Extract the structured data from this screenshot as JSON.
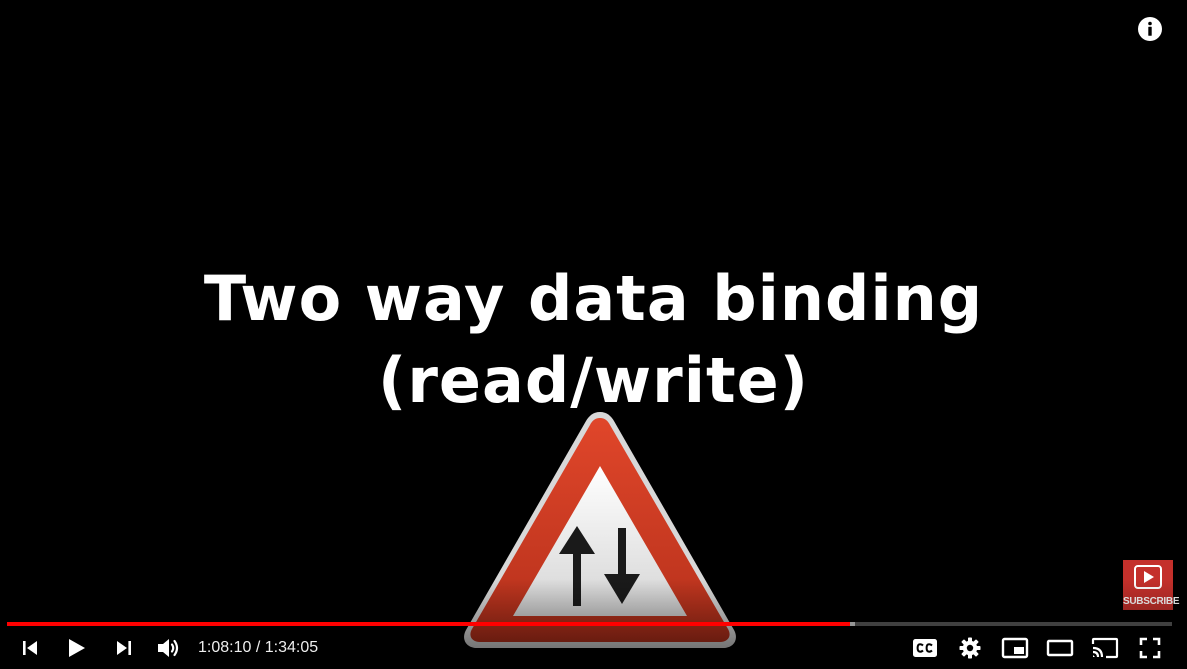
{
  "video": {
    "title_line1": "Two way data binding",
    "title_line2": "(read/write)",
    "sign_icon": "two-way-traffic-warning-sign"
  },
  "player": {
    "current_time": "1:08:10",
    "separator": " / ",
    "duration": "1:34:05",
    "progress_played_fraction": 0.724,
    "progress_buffered_fraction": 0.728,
    "accent_color": "#ff0000"
  },
  "controls": {
    "left": [
      "previous-icon",
      "play-icon",
      "next-icon",
      "volume-icon"
    ],
    "right": [
      "closed-captions-icon",
      "settings-gear-icon",
      "miniplayer-icon",
      "theater-mode-icon",
      "cast-icon",
      "fullscreen-icon"
    ]
  },
  "overlays": {
    "info_icon": "info-icon",
    "subscribe_label": "SUBSCRIBE",
    "subscribe_color": "#c4302b"
  }
}
